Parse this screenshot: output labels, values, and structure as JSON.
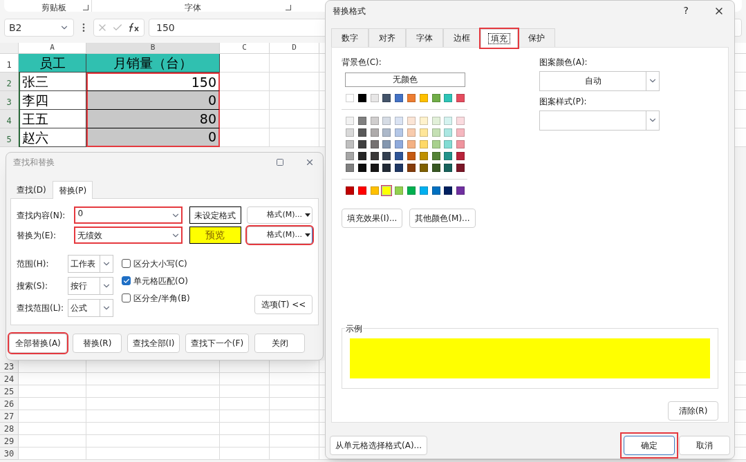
{
  "ribbon": {
    "groups": [
      {
        "label": "剪贴板"
      },
      {
        "label": "字体"
      }
    ]
  },
  "formula_bar": {
    "name_box": "B2",
    "value": "150"
  },
  "sheet": {
    "columns": [
      "A",
      "B",
      "C",
      "D"
    ],
    "highlight_b_range": true,
    "rows": [
      {
        "number": "1",
        "kind": "header",
        "cells": [
          "员工",
          "月销量（台）"
        ]
      },
      {
        "number": "2",
        "kind": "data",
        "cells": [
          "张三",
          "150"
        ],
        "shaded": false
      },
      {
        "number": "3",
        "kind": "data",
        "cells": [
          "李四",
          "0"
        ],
        "shaded": true
      },
      {
        "number": "4",
        "kind": "data",
        "cells": [
          "王五",
          "80"
        ],
        "shaded": true
      },
      {
        "number": "5",
        "kind": "data",
        "cells": [
          "赵六",
          "0"
        ],
        "shaded": true
      }
    ],
    "lower_rows": [
      "23",
      "24",
      "25",
      "26",
      "27",
      "28",
      "29",
      "30"
    ]
  },
  "find_dialog": {
    "title": "查找和替换",
    "tabs": [
      {
        "label": "查找(D)",
        "selected": false
      },
      {
        "label": "替换(P)",
        "selected": true
      }
    ],
    "fields": [
      {
        "label": "查找内容(N):",
        "value": "0",
        "highlighted": true,
        "format_button": "格式(M)...",
        "format_highlighted": false
      },
      {
        "label": "替换为(E):",
        "value": "无绩效",
        "highlighted": true,
        "format_button": "格式(M)...",
        "format_highlighted": true
      }
    ],
    "format_previews": [
      {
        "kind": "unset",
        "label": "未设定格式"
      },
      {
        "kind": "preview",
        "label": "预览"
      }
    ],
    "selects": [
      {
        "label": "范围(H):",
        "value": "工作表"
      },
      {
        "label": "搜索(S):",
        "value": "按行"
      },
      {
        "label": "查找范围(L):",
        "value": "公式"
      }
    ],
    "checkboxes": [
      {
        "label": "区分大小写(C)",
        "checked": false
      },
      {
        "label": "单元格匹配(O)",
        "checked": true
      },
      {
        "label": "区分全/半角(B)",
        "checked": false
      }
    ],
    "options_button": "选项(T) <<",
    "buttons": [
      {
        "label": "全部替换(A)",
        "highlighted": true
      },
      {
        "label": "替换(R)",
        "highlighted": false
      },
      {
        "label": "查找全部(I)",
        "highlighted": false
      },
      {
        "label": "查找下一个(F)",
        "highlighted": false
      },
      {
        "label": "关闭",
        "highlighted": false
      }
    ]
  },
  "format_dialog": {
    "title": "替换格式",
    "help": "?",
    "tabs": [
      {
        "label": "数字",
        "selected": false,
        "highlighted": false
      },
      {
        "label": "对齐",
        "selected": false,
        "highlighted": false
      },
      {
        "label": "字体",
        "selected": false,
        "highlighted": false
      },
      {
        "label": "边框",
        "selected": false,
        "highlighted": false
      },
      {
        "label": "填充",
        "selected": true,
        "highlighted": true
      },
      {
        "label": "保护",
        "selected": false,
        "highlighted": false
      }
    ],
    "background_label": "背景色(C):",
    "no_color_button": "无颜色",
    "theme_colors": [
      {
        "color": "#ffffff",
        "selected": false
      },
      {
        "color": "#000000",
        "selected": false
      },
      {
        "color": "#e7e6e6",
        "selected": false
      },
      {
        "color": "#44546a",
        "selected": false
      },
      {
        "color": "#4472c4",
        "selected": false
      },
      {
        "color": "#ed7d31",
        "selected": false
      },
      {
        "color": "#ffc000",
        "selected": false
      },
      {
        "color": "#70ad47",
        "selected": false
      },
      {
        "color": "#2ec4b6",
        "selected": false
      },
      {
        "color": "#e54c5e",
        "selected": false
      }
    ],
    "tint_rows": [
      [
        {
          "color": "#f2f2f2",
          "selected": false
        },
        {
          "color": "#808080",
          "selected": false
        },
        {
          "color": "#d0cece",
          "selected": false
        },
        {
          "color": "#d6dce5",
          "selected": false
        },
        {
          "color": "#dae3f3",
          "selected": false
        },
        {
          "color": "#fbe5d6",
          "selected": false
        },
        {
          "color": "#fff2cc",
          "selected": false
        },
        {
          "color": "#e2f0d9",
          "selected": false
        },
        {
          "color": "#d5f3f0",
          "selected": false
        },
        {
          "color": "#fadbdf",
          "selected": false
        }
      ],
      [
        {
          "color": "#d9d9d9",
          "selected": false
        },
        {
          "color": "#595959",
          "selected": false
        },
        {
          "color": "#aeabab",
          "selected": false
        },
        {
          "color": "#adb9ca",
          "selected": false
        },
        {
          "color": "#b4c7e7",
          "selected": false
        },
        {
          "color": "#f8cbad",
          "selected": false
        },
        {
          "color": "#ffe699",
          "selected": false
        },
        {
          "color": "#c5e0b4",
          "selected": false
        },
        {
          "color": "#abe7e2",
          "selected": false
        },
        {
          "color": "#f5b7bf",
          "selected": false
        }
      ],
      [
        {
          "color": "#bfbfbf",
          "selected": false
        },
        {
          "color": "#404040",
          "selected": false
        },
        {
          "color": "#757171",
          "selected": false
        },
        {
          "color": "#8497b0",
          "selected": false
        },
        {
          "color": "#8faadc",
          "selected": false
        },
        {
          "color": "#f4b183",
          "selected": false
        },
        {
          "color": "#ffd966",
          "selected": false
        },
        {
          "color": "#a9d18e",
          "selected": false
        },
        {
          "color": "#82dcd3",
          "selected": false
        },
        {
          "color": "#ef949e",
          "selected": false
        }
      ],
      [
        {
          "color": "#a6a6a6",
          "selected": false
        },
        {
          "color": "#262626",
          "selected": false
        },
        {
          "color": "#3a3838",
          "selected": false
        },
        {
          "color": "#333f50",
          "selected": false
        },
        {
          "color": "#2f5597",
          "selected": false
        },
        {
          "color": "#c55a11",
          "selected": false
        },
        {
          "color": "#bf9000",
          "selected": false
        },
        {
          "color": "#548235",
          "selected": false
        },
        {
          "color": "#22938a",
          "selected": false
        },
        {
          "color": "#b8233a",
          "selected": false
        }
      ],
      [
        {
          "color": "#808080",
          "selected": false
        },
        {
          "color": "#0d0d0d",
          "selected": false
        },
        {
          "color": "#171616",
          "selected": false
        },
        {
          "color": "#222a35",
          "selected": false
        },
        {
          "color": "#203864",
          "selected": false
        },
        {
          "color": "#843c0c",
          "selected": false
        },
        {
          "color": "#7f6000",
          "selected": false
        },
        {
          "color": "#385723",
          "selected": false
        },
        {
          "color": "#17625b",
          "selected": false
        },
        {
          "color": "#7a1727",
          "selected": false
        }
      ]
    ],
    "standard_colors": [
      {
        "color": "#c00000",
        "selected": false
      },
      {
        "color": "#ff0000",
        "selected": false
      },
      {
        "color": "#ffc000",
        "selected": false
      },
      {
        "color": "#ffff00",
        "selected": true
      },
      {
        "color": "#92d050",
        "selected": false
      },
      {
        "color": "#00b050",
        "selected": false
      },
      {
        "color": "#00b0f0",
        "selected": false
      },
      {
        "color": "#0070c0",
        "selected": false
      },
      {
        "color": "#002060",
        "selected": false
      },
      {
        "color": "#7030a0",
        "selected": false
      }
    ],
    "color_buttons": [
      "填充效果(I)...",
      "其他颜色(M)..."
    ],
    "pattern_color": {
      "label": "图案颜色(A):",
      "value": "自动"
    },
    "pattern_style": {
      "label": "图案样式(P):"
    },
    "sample_label": "示例",
    "clear_button": "清除(R)",
    "pick_button": "从单元格选择格式(A)...",
    "ok": {
      "label": "确定",
      "highlighted": true
    },
    "cancel": {
      "label": "取消",
      "highlighted": false
    }
  }
}
